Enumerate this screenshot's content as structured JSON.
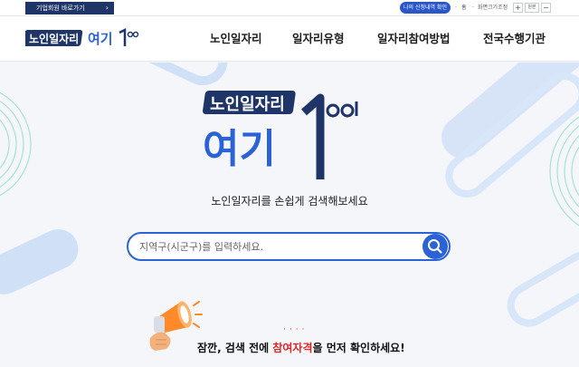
{
  "util_bar": {
    "business_button": "기업회원 바로가기",
    "apply_check_button": "나의 신청내역 확인",
    "home_label": "홈",
    "zoom_label": "화면크기조정",
    "zoom_in": "+",
    "zoom_reset": "원본",
    "zoom_out": "−"
  },
  "header": {
    "logo_text_top": "노인일자리",
    "logo_text_bottom": "여기",
    "nav": [
      "노인일자리",
      "일자리유형",
      "일자리참여방법",
      "전국수행기관"
    ]
  },
  "hero": {
    "logo_top": "노인일자리",
    "logo_bottom": "여기",
    "subtitle": "노인일자리를 손쉽게 검색해보세요",
    "search_placeholder": "지역구(시군구)를 입력하세요.",
    "notice_prefix": "잠깐, 검색 전에 ",
    "notice_highlight": "참여자격",
    "notice_suffix": "을 먼저 확인하세요!",
    "emphasis_dots": "····"
  },
  "colors": {
    "brand_navy": "#1f3568",
    "brand_blue": "#2b63d6",
    "highlight_red": "#e12525",
    "deco_green": "#a6e3cf",
    "deco_blue": "#b8d3f5"
  },
  "icons": [
    "search-icon",
    "megaphone-icon",
    "hand-icon"
  ]
}
